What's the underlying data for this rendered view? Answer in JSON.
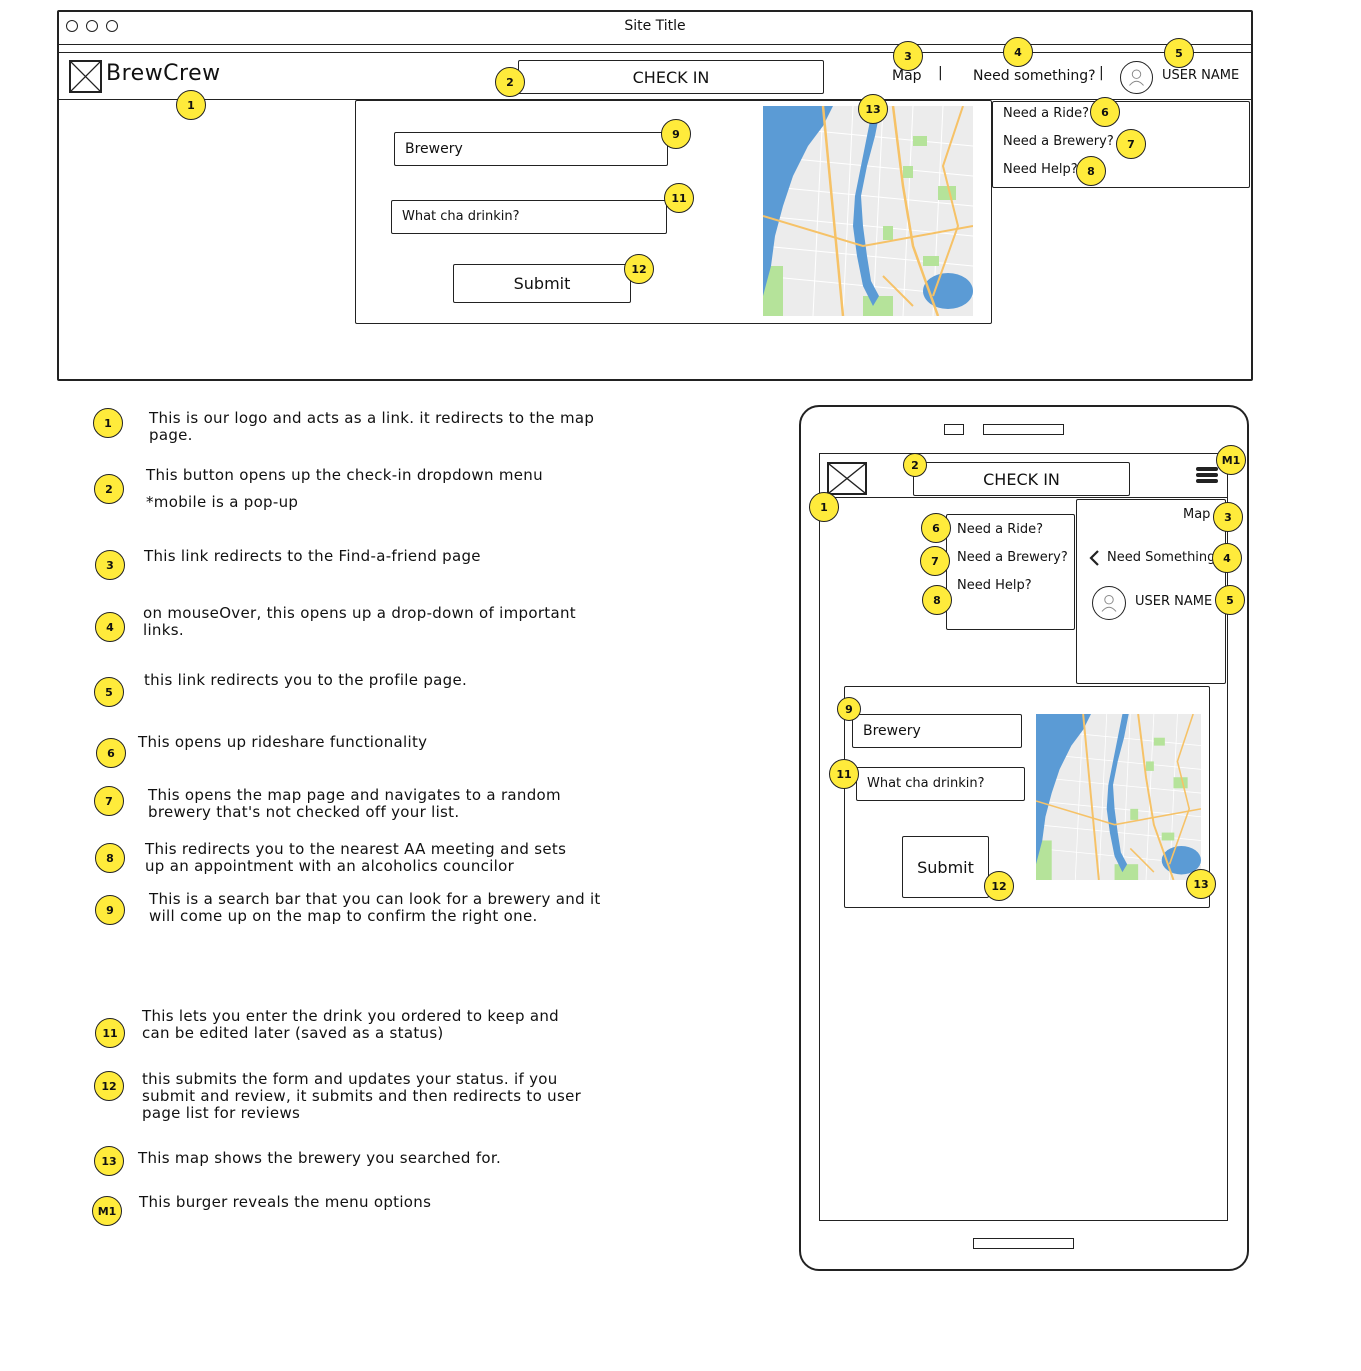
{
  "desktop": {
    "window_title": "Site Title",
    "logo_text": "BrewCrew",
    "check_in_label": "CHECK IN",
    "nav_map": "Map",
    "nav_need_something": "Need something?",
    "separator": "|",
    "user_name": "USER NAME",
    "dropdown": [
      "Need a Ride?",
      "Need a Brewery?",
      "Need Help?"
    ],
    "form": {
      "brewery": "Brewery",
      "drink": "What cha drinkin?",
      "submit": "Submit"
    }
  },
  "mobile": {
    "check_in_label": "CHECK IN",
    "menu_map": "Map",
    "menu_need_something": "Need Something?",
    "user_name": "USER NAME",
    "dropdown": [
      "Need a Ride?",
      "Need a Brewery?",
      "Need Help?"
    ],
    "form": {
      "brewery": "Brewery",
      "drink": "What cha drinkin?",
      "submit": "Submit"
    }
  },
  "badges": {
    "b1": "1",
    "b2": "2",
    "b3": "3",
    "b4": "4",
    "b5": "5",
    "b6": "6",
    "b7": "7",
    "b8": "8",
    "b9": "9",
    "b11": "11",
    "b12": "12",
    "b13": "13",
    "m1": "M1"
  },
  "notes": [
    {
      "badge": "1",
      "text": "This is our logo and acts as a link. it redirects to the map page."
    },
    {
      "badge": "2",
      "text": "This button opens up the check-in dropdown menu",
      "extra": "*mobile is a pop-up"
    },
    {
      "badge": "3",
      "text": "This link redirects to the Find-a-friend page"
    },
    {
      "badge": "4",
      "text": "on mouseOver, this opens up a drop-down of important links."
    },
    {
      "badge": "5",
      "text": "this link redirects you to the profile page."
    },
    {
      "badge": "6",
      "text": "This opens up rideshare functionality"
    },
    {
      "badge": "7",
      "text": "This opens the map page and navigates to a random brewery that's not checked off your list."
    },
    {
      "badge": "8",
      "text": "This redirects you to the nearest AA meeting and sets up an appointment with an alcoholics councilor"
    },
    {
      "badge": "9",
      "text": "This is a search bar that you can look for a brewery and it will come up on the map to confirm the right one."
    },
    {
      "badge": "11",
      "text": "This lets you enter the drink you ordered to keep and can be edited later (saved as a status)"
    },
    {
      "badge": "12",
      "text": "this submits the form and updates your status. if you submit and review, it submits and then redirects to user page list for reviews"
    },
    {
      "badge": "13",
      "text": "This map shows the brewery you searched for."
    },
    {
      "badge": "M1",
      "text": "This burger reveals the menu options"
    }
  ],
  "colors": {
    "badge_fill": "#ffeb3b",
    "map_water": "#5b9bd5",
    "map_park": "#b5e39a",
    "map_road": "#f6c267",
    "map_land": "#eeeeee"
  }
}
